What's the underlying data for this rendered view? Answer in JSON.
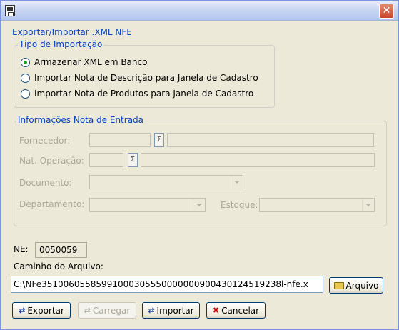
{
  "window": {
    "close_symbol": "✕",
    "app_icon": "floppy-disk-icon"
  },
  "export_group": {
    "legend": "Exportar/Importar .XML NFE"
  },
  "import_type": {
    "legend": "Tipo de Importação",
    "options": [
      {
        "label": "Armazenar XML em Banco",
        "checked": true
      },
      {
        "label": "Importar Nota de Descrição para Janela de Cadastro",
        "checked": false
      },
      {
        "label": "Importar Nota de Produtos para Janela de Cadastro",
        "checked": false
      }
    ]
  },
  "entry_info": {
    "legend": "Informações Nota de Entrada",
    "fornecedor_label": "Fornecedor:",
    "nat_operacao_label": "Nat. Operação:",
    "documento_label": "Documento:",
    "departamento_label": "Departamento:",
    "estoque_label": "Estoque:",
    "lookup_glyph": "Ʃ"
  },
  "ne": {
    "label": "NE:",
    "value": "0050059"
  },
  "path": {
    "label": "Caminho do Arquivo:",
    "value": "C:\\NFe35100605585991000305550000000900430124519238l-nfe.x"
  },
  "buttons": {
    "arquivo": "Arquivo",
    "exportar": "Exportar",
    "carregar": "Carregar",
    "importar": "Importar",
    "cancelar": "Cancelar"
  },
  "colors": {
    "legend": "#0a46c8",
    "disabled_text": "#aca899",
    "background": "#ece9d8"
  }
}
